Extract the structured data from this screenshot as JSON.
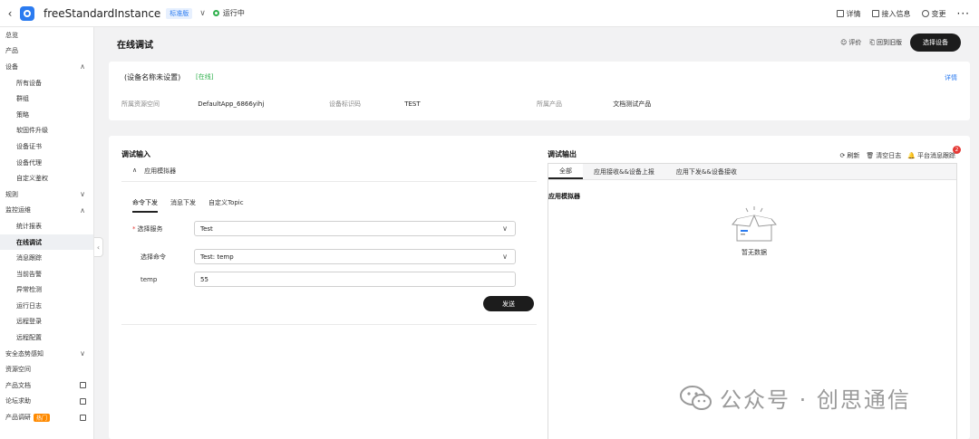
{
  "topbar": {
    "instance_name": "freeStandardInstance",
    "edition_badge": "标准版",
    "status": "运行中",
    "actions": [
      "详情",
      "接入信息",
      "变更"
    ]
  },
  "sidebar": {
    "items": [
      {
        "label": "总览",
        "level": 1
      },
      {
        "label": "产品",
        "level": 1
      },
      {
        "label": "设备",
        "level": 1,
        "chevron": "up"
      },
      {
        "label": "所有设备",
        "level": 2
      },
      {
        "label": "群组",
        "level": 2
      },
      {
        "label": "策略",
        "level": 2
      },
      {
        "label": "软固件升级",
        "level": 2
      },
      {
        "label": "设备证书",
        "level": 2
      },
      {
        "label": "设备代理",
        "level": 2
      },
      {
        "label": "自定义鉴权",
        "level": 2
      },
      {
        "label": "规则",
        "level": 1,
        "chevron": "down"
      },
      {
        "label": "监控运维",
        "level": 1,
        "chevron": "up"
      },
      {
        "label": "统计报表",
        "level": 2
      },
      {
        "label": "在线调试",
        "level": 2,
        "active": true
      },
      {
        "label": "消息跟踪",
        "level": 2
      },
      {
        "label": "当前告警",
        "level": 2
      },
      {
        "label": "异常检测",
        "level": 2
      },
      {
        "label": "运行日志",
        "level": 2
      },
      {
        "label": "远程登录",
        "level": 2
      },
      {
        "label": "远程配置",
        "level": 2
      },
      {
        "label": "安全态势感知",
        "level": 1,
        "chevron": "down"
      },
      {
        "label": "资源空间",
        "level": 1
      },
      {
        "label": "产品文档",
        "level": 1,
        "external": true
      },
      {
        "label": "论坛求助",
        "level": 1,
        "external": true
      },
      {
        "label": "产品调研",
        "level": 1,
        "external": true,
        "badge": "热门"
      }
    ]
  },
  "header": {
    "title": "在线调试",
    "rate": "评价",
    "back_old": "回到旧版",
    "select_device": "选择设备"
  },
  "device": {
    "name": "(设备名称未设置)",
    "online": "[在线]",
    "detail_link": "详情",
    "fields": [
      {
        "k": "所属资源空间",
        "v": "DefaultApp_6866yihj"
      },
      {
        "k": "设备标识码",
        "v": "TEST"
      },
      {
        "k": "所属产品",
        "v": "文档测试产品"
      }
    ]
  },
  "debug_input": {
    "title": "调试输入",
    "simulator_label": "应用模拟器",
    "tabs": [
      "命令下发",
      "消息下发",
      "自定义Topic"
    ],
    "service_label": "选择服务",
    "service_value": "Test",
    "command_label": "选择命令",
    "command_value": "Test: temp",
    "param_label": "temp",
    "param_value": "55",
    "send": "发送"
  },
  "debug_output": {
    "title": "调试输出",
    "refresh": "刷新",
    "clear_log": "清空日志",
    "platform_trace": "平台消息跟踪",
    "notif_count": "2",
    "tabs": [
      "全部",
      "应用接收&&设备上报",
      "应用下发&&设备接收"
    ],
    "section": "应用模拟器",
    "empty": "暂无数据"
  },
  "watermark": "公众号 · 创思通信"
}
